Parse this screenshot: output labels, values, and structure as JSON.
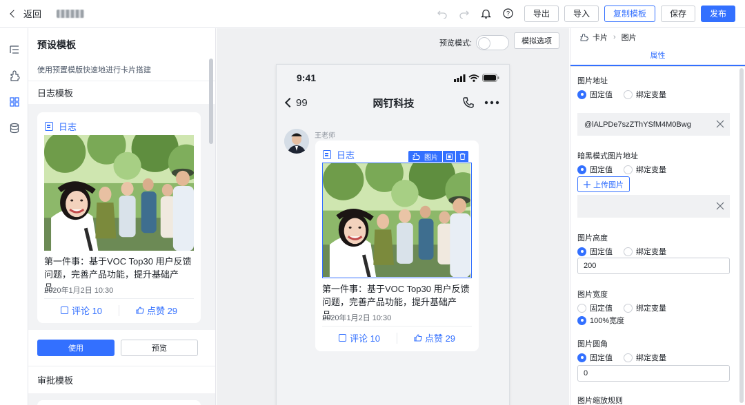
{
  "topbar": {
    "back_label": "返回",
    "export": "导出",
    "import": "导入",
    "copy_template": "复制模板",
    "save": "保存",
    "publish": "发布"
  },
  "rail": {
    "icons": [
      "outline-icon",
      "component-icon",
      "template-icon",
      "data-icon"
    ]
  },
  "template_panel": {
    "title": "预设模板",
    "subtitle": "使用预置模版快速地进行卡片搭建",
    "section_log": "日志模板",
    "section_approval": "审批模板",
    "use_button": "使用",
    "preview_button": "预览"
  },
  "log_card": {
    "tag": "日志",
    "text": "第一件事：基于VOC Top30 用户反馈问题，完善产品功能，提升基础产品…",
    "date": "2020年1月2日 10:30",
    "comment": "评论 10",
    "like": "点赞 29"
  },
  "preview": {
    "mode_label": "预览模式:",
    "sim_options": "模拟选项",
    "time": "9:41",
    "back_count": "99",
    "chat_title": "网钉科技",
    "sender": "王老师",
    "image_badge": "图片"
  },
  "props": {
    "crumb_card": "卡片",
    "crumb_image": "图片",
    "tab": "属性",
    "image_url": {
      "label": "图片地址",
      "opt_fixed": "固定值",
      "opt_bind": "绑定变量",
      "value": "@lALPDe7szZThYSfM4M0Bwg"
    },
    "dark_url": {
      "label": "暗黑模式图片地址",
      "opt_fixed": "固定值",
      "opt_bind": "绑定变量",
      "upload": "上传图片",
      "value": ""
    },
    "height": {
      "label": "图片高度",
      "opt_fixed": "固定值",
      "opt_bind": "绑定变量",
      "value": "200"
    },
    "width": {
      "label": "图片宽度",
      "opt_fixed": "固定值",
      "opt_bind": "绑定变量",
      "opt_full": "100%宽度"
    },
    "radius": {
      "label": "图片圆角",
      "opt_fixed": "固定值",
      "opt_bind": "绑定变量",
      "value": "0"
    },
    "scale": {
      "label": "图片缩放规则"
    }
  },
  "colors": {
    "primary": "#3370ff",
    "panel_bg": "#f2f3f5",
    "preview_bg": "#eff0f2"
  }
}
